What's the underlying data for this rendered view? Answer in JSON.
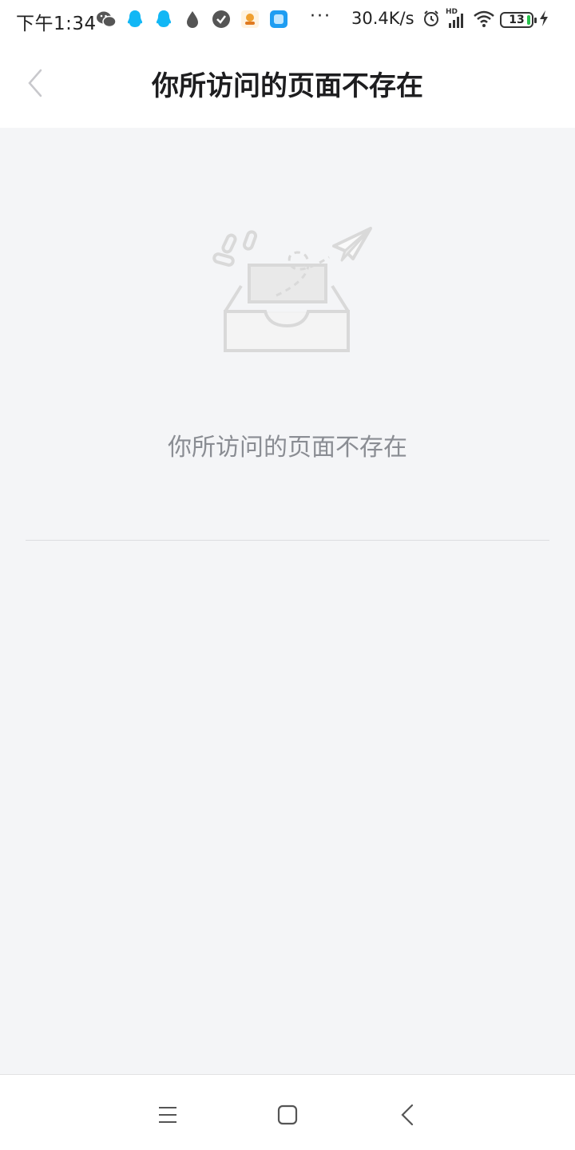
{
  "status_bar": {
    "time": "下午1:34",
    "dots": "···",
    "net_speed": "30.4K/s",
    "signal_tag": "HD",
    "battery": "13"
  },
  "header": {
    "title": "你所访问的页面不存在"
  },
  "content": {
    "message": "你所访问的页面不存在"
  },
  "colors": {
    "background": "#f4f5f7",
    "title_text": "#1d1d1f",
    "message_text": "#8a8d93",
    "qq_blue": "#12b7f5",
    "battery_green": "#27c24c"
  },
  "icons": {
    "back": "chevron-left-icon",
    "empty": "empty-inbox-paper-plane-icon",
    "nav_menu": "menu-icon",
    "nav_home": "home-square-icon",
    "nav_back": "back-triangle-icon"
  }
}
